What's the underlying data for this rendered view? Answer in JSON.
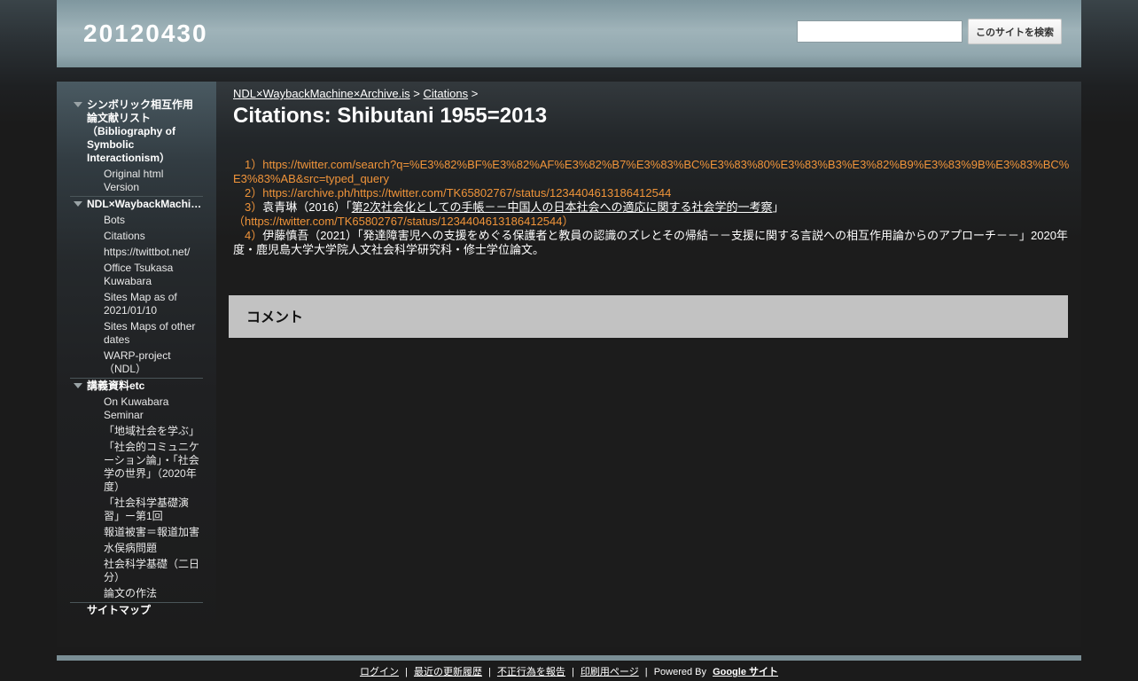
{
  "header": {
    "site_title": "20120430",
    "search_placeholder": "",
    "search_button": "このサイトを検索"
  },
  "sidebar": {
    "sections": [
      {
        "label": "シンボリック相互作用論文献リスト（Bibliography of Symbolic Interactionism）",
        "children": [
          "Original html Version"
        ]
      },
      {
        "label": "NDL×WaybackMachi…",
        "children": [
          "Bots",
          "Citations",
          "https://twittbot.net/",
          "Office Tsukasa Kuwabara",
          "Sites Map as of 2021/01/10",
          "Sites Maps of other dates",
          "WARP-project（NDL）"
        ]
      },
      {
        "label": "講義資料etc",
        "children": [
          "On Kuwabara Seminar",
          "「地域社会を学ぶ」",
          "「社会的コミュニケーション論」・「社会学の世界」（2020年度）",
          "「社会科学基礎演習」ー第1回",
          "報道被害＝報道加害",
          "水俣病問題",
          "社会科学基礎（二日分）",
          "論文の作法"
        ]
      },
      {
        "label": "サイトマップ",
        "children": []
      }
    ]
  },
  "breadcrumb": {
    "item1": "NDL×WaybackMachine×Archive.is",
    "sep": ">",
    "item2": "Citations"
  },
  "page_title": "Citations: Shibutani 1955=2013",
  "citations": {
    "c1_num": "　1）",
    "c1_url": "https://twitter.com/search?q=%E3%82%BF%E3%82%AF%E3%82%B7%E3%83%BC%E3%83%80%E3%83%B3%E3%82%B9%E3%83%9B%E3%83%BC%E3%83%AB&src=typed_query",
    "c2_num": "　2）",
    "c2_url": "https://archive.ph/https://twitter.com/TK65802767/status/1234404613186412544",
    "c3_num": "　3）",
    "c3_author": "袁青琳（2016）「",
    "c3_title": "第2次社会化としての手帳－－中国人の日本社会への適応に関する社会学的一考察",
    "c3_close": "」",
    "c3_url": "（https://twitter.com/TK65802767/status/1234404613186412544）",
    "c4_num": "　4）",
    "c4_text": "伊藤慎吾（2021）「発達障害児への支援をめぐる保護者と教員の認識のズレとその帰結－－支援に関する言説への相互作用論からのアプローチ－－」2020年度・鹿児島大学大学院人文社会科学研究科・修士学位論文。"
  },
  "comments": {
    "title": "コメント"
  },
  "footer": {
    "login": "ログイン",
    "recent": "最近の更新履歴",
    "report": "不正行為を報告",
    "print": "印刷用ページ",
    "powered": "Powered By",
    "google_sites": "Google サイト",
    "sep": "|"
  },
  "colors": {
    "accent_orange": "#f0943a",
    "header_bg": "#9fb3b9",
    "comments_bg": "#c2c2c2",
    "page_bg": "#1b1b1b"
  }
}
